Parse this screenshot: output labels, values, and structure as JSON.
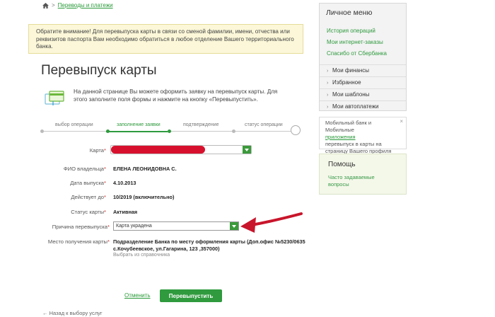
{
  "breadcrumb": {
    "home_icon": "home-icon",
    "separator": ">",
    "link": "Переводы и платежи"
  },
  "notice": "Обратите внимание! Для перевыпуска карты в связи со сменой фамилии, имени, отчества или реквизитов паспорта Вам необходимо обратиться в любое отделение Вашего территориального банка.",
  "page_title": "Перевыпуск карты",
  "intro": "На данной странице Вы можете оформить заявку на перевыпуск карты. Для этого заполните поля формы и нажмите на кнопку «Перевыпустить».",
  "steps": [
    {
      "label": "выбор операции",
      "state": "done"
    },
    {
      "label": "заполнение заявки",
      "state": "active"
    },
    {
      "label": "подтверждение",
      "state": "pending"
    },
    {
      "label": "статус операции",
      "state": "pending"
    }
  ],
  "form": {
    "card_label": "Карта",
    "owner_label": "ФИО владельца",
    "owner_value": "ЕЛЕНА ЛЕОНИДОВНА С.",
    "issue_label": "Дата выпуска",
    "issue_value": "4.10.2013",
    "valid_label": "Действует до",
    "valid_value": "10/2019 (включительно)",
    "status_label": "Статус карты",
    "status_value": "Активная",
    "reason_label": "Причина перевыпуска",
    "reason_value": "Карта украдена",
    "place_label": "Место получения карты",
    "place_value_1": "Подразделение Банка по месту оформления карты (Доп.офис №5230/0635",
    "place_value_2": "с.Кочубеевское, ул.Гагарина, 123 ,357000)",
    "place_link": "Выбрать из справочника",
    "required_mark": "*"
  },
  "actions": {
    "cancel": "Отменить",
    "submit": "Перевыпустить",
    "back": "← Назад к выбору услуг"
  },
  "sidebar": {
    "title": "Личное меню",
    "links": [
      "История операций",
      "Мои интернет-заказы",
      "Спасибо от Сбербанка"
    ],
    "sections": [
      "Мои финансы",
      "Избранное",
      "Мои шаблоны",
      "Мои автоплатежи"
    ],
    "promo_1": "Мобильный банк и Мобильные",
    "promo_2": "приложения",
    "promo_3": "перевыпуск в карты на",
    "promo_4": "страницу Вашего профиля",
    "promo_close": "×",
    "help_title": "Помощь",
    "help_link": "Часто задаваемые вопросы"
  },
  "colors": {
    "accent": "#2f9a3e",
    "notice_bg": "#fbf7d8",
    "redaction": "#d7112d",
    "arrow": "#c8152b"
  }
}
